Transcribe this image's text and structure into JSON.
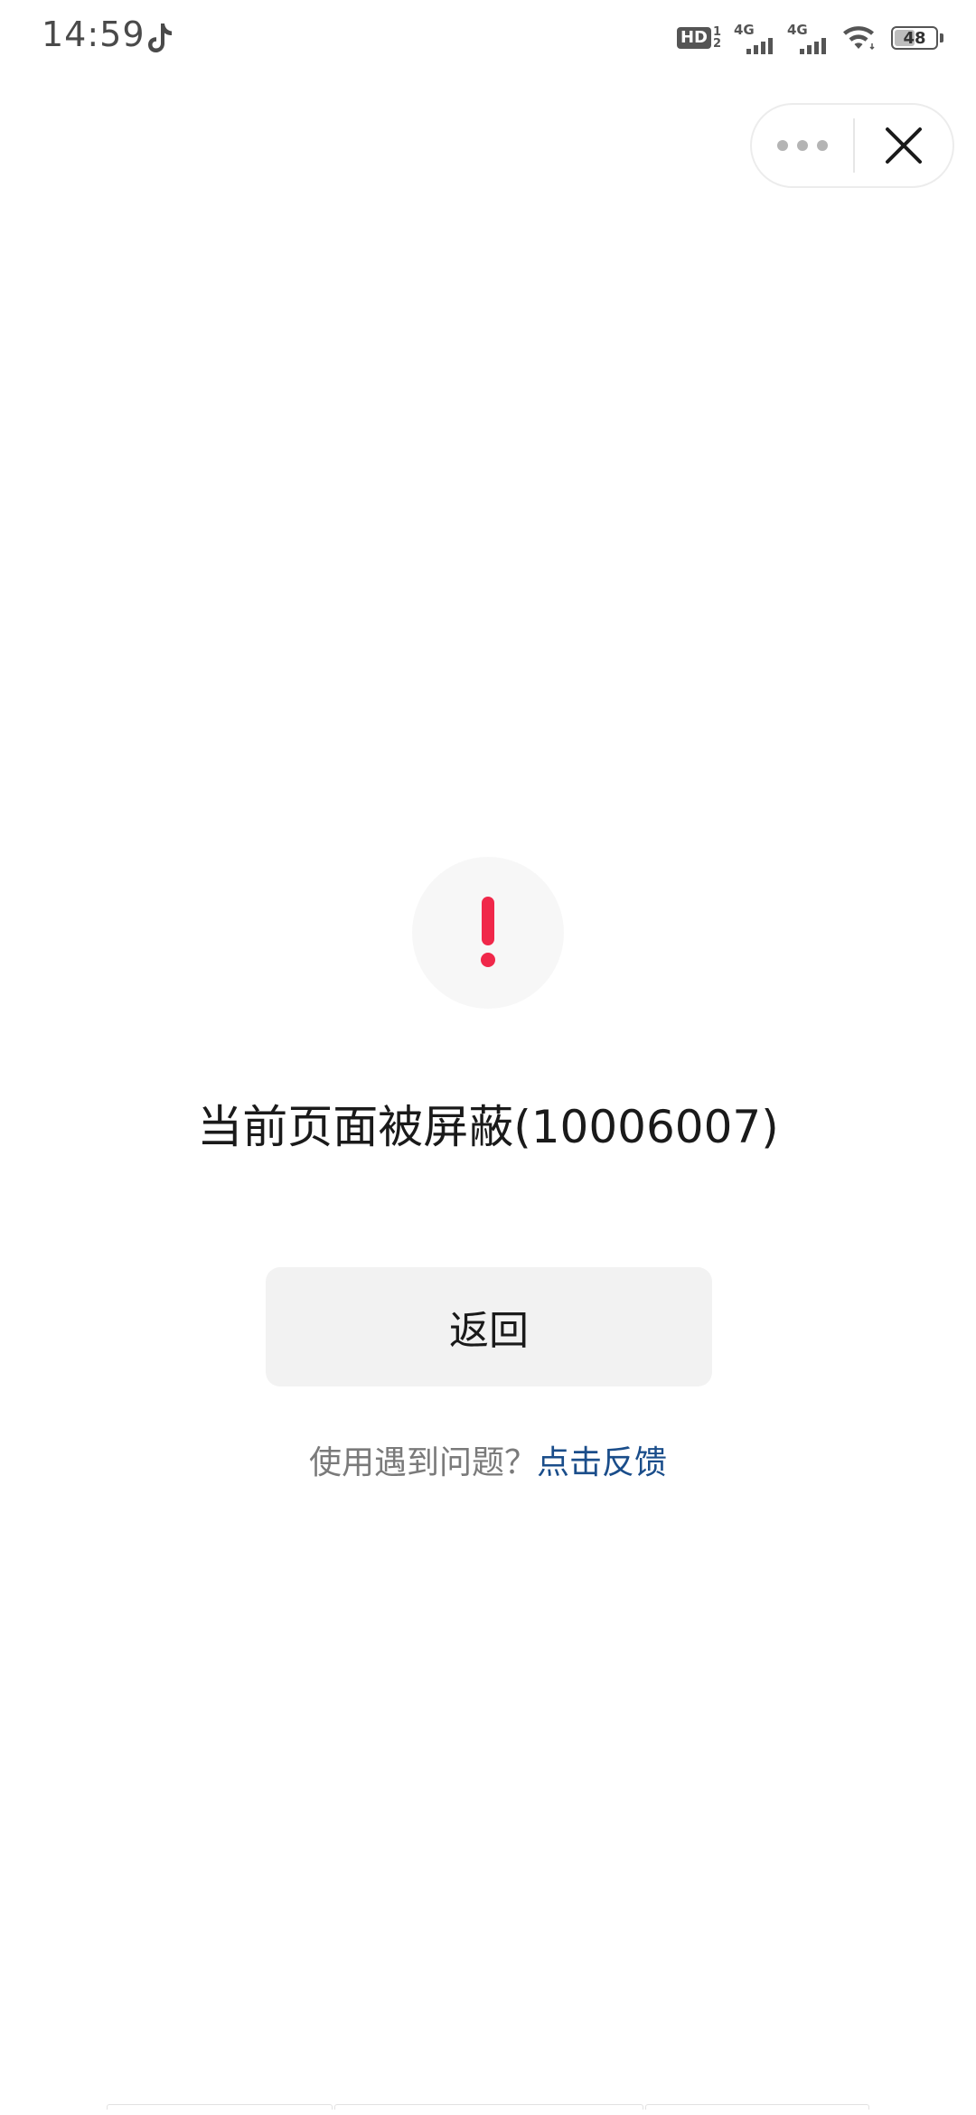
{
  "status_bar": {
    "time": "14:59",
    "hd_label": "HD",
    "hd_sub_top": "1",
    "hd_sub_bottom": "2",
    "signal1_label": "4G",
    "signal2_label": "4G",
    "battery_level": "48",
    "app_icon": "tiktok-icon",
    "wifi_icon": "wifi-icon"
  },
  "capsule": {
    "more_icon": "more-dots-icon",
    "close_icon": "close-icon"
  },
  "main": {
    "warning_icon": "exclamation-icon",
    "warning_color": "#f0284a",
    "title": "当前页面被屏蔽(10006007)",
    "back_button_label": "返回",
    "feedback_prompt": "使用遇到问题？",
    "feedback_link": "点击反馈",
    "link_color": "#1a4d8a"
  }
}
